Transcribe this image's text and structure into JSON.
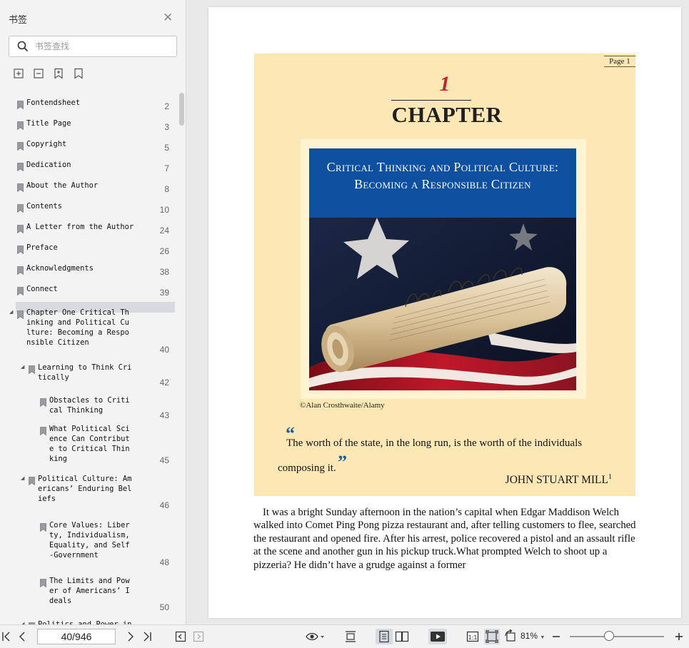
{
  "sidebar": {
    "title": "书签",
    "search_placeholder": "书签查找",
    "bookmarks": [
      {
        "label": "Fontendsheet",
        "page": "2"
      },
      {
        "label": "Title Page",
        "page": "3"
      },
      {
        "label": "Copyright",
        "page": "5"
      },
      {
        "label": "Dedication",
        "page": "7"
      },
      {
        "label": "About the Author",
        "page": "8"
      },
      {
        "label": "Contents",
        "page": "10"
      },
      {
        "label": "A Letter from the Author",
        "page": "24"
      },
      {
        "label": "Preface",
        "page": "26"
      },
      {
        "label": "Acknowledgments",
        "page": "38"
      },
      {
        "label": "Connect",
        "page": "39"
      },
      {
        "label": "Chapter One Critical Thinking and Political Culture: Becoming a Responsible Citizen",
        "page": "40"
      },
      {
        "label": "Learning to Think Critically",
        "page": "42"
      },
      {
        "label": "Obstacles to Critical Thinking",
        "page": "43"
      },
      {
        "label": "What Political Science Can Contribute to Critical Thinking",
        "page": "45"
      },
      {
        "label": "Political Culture: Americans’ Enduring Beliefs",
        "page": "46"
      },
      {
        "label": "Core Values: Liberty, Individualism, Equality, and Self-Government",
        "page": "48"
      },
      {
        "label": "The Limits and Power of Americans’ Ideals",
        "page": "50"
      },
      {
        "label": "Politics and Power in America",
        "page": ""
      }
    ]
  },
  "document": {
    "page_label": "Page 1",
    "chapter_number": "1",
    "chapter_word": "CHAPTER",
    "figure_title": "Critical Thinking and Political Culture: Becoming a Responsible Citizen",
    "photo_credit": "©Alan Crosthwaite/Alamy",
    "quote_open": "“",
    "quote_close": "”",
    "quote": "The worth of the state, in the long run, is the worth of the individuals composing it.",
    "attribution": "JOHN STUART MILL",
    "attribution_note": "1",
    "body": "It was a bright Sunday afternoon in the nation’s capital when Edgar Maddison Welch walked into Comet Ping Pong pizza restaurant and, after telling customers to flee, searched the restaurant and opened fire. After his arrest, police recovered a pistol and an assault rifle at the scene and another gun in his pickup truck.What prompted Welch to shoot up a pizzeria? He didn’t have a grudge against a former"
  },
  "toolbar": {
    "page_indicator": "40/946",
    "zoom": "81%",
    "zoom_fraction": 0.42
  }
}
